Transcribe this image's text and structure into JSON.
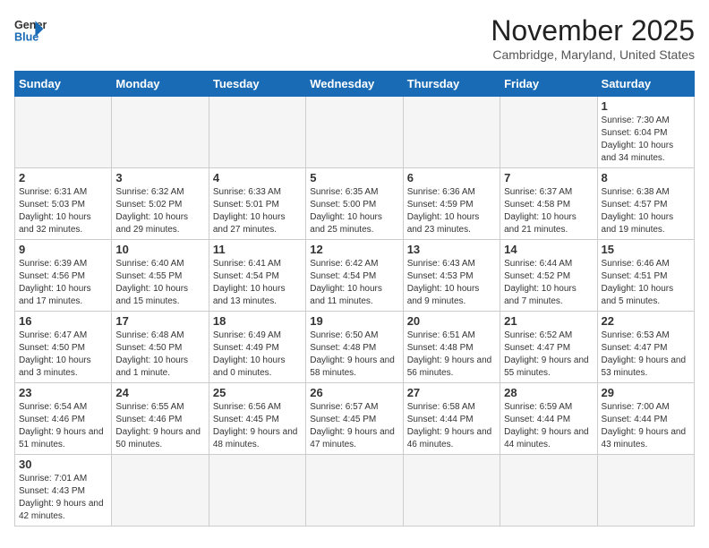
{
  "header": {
    "logo_line1": "General",
    "logo_line2": "Blue",
    "month": "November 2025",
    "location": "Cambridge, Maryland, United States"
  },
  "days_of_week": [
    "Sunday",
    "Monday",
    "Tuesday",
    "Wednesday",
    "Thursday",
    "Friday",
    "Saturday"
  ],
  "weeks": [
    [
      {
        "day": "",
        "empty": true
      },
      {
        "day": "",
        "empty": true
      },
      {
        "day": "",
        "empty": true
      },
      {
        "day": "",
        "empty": true
      },
      {
        "day": "",
        "empty": true
      },
      {
        "day": "",
        "empty": true
      },
      {
        "day": "1",
        "info": "Sunrise: 7:30 AM\nSunset: 6:04 PM\nDaylight: 10 hours\nand 34 minutes."
      }
    ],
    [
      {
        "day": "2",
        "info": "Sunrise: 6:31 AM\nSunset: 5:03 PM\nDaylight: 10 hours\nand 32 minutes."
      },
      {
        "day": "3",
        "info": "Sunrise: 6:32 AM\nSunset: 5:02 PM\nDaylight: 10 hours\nand 29 minutes."
      },
      {
        "day": "4",
        "info": "Sunrise: 6:33 AM\nSunset: 5:01 PM\nDaylight: 10 hours\nand 27 minutes."
      },
      {
        "day": "5",
        "info": "Sunrise: 6:35 AM\nSunset: 5:00 PM\nDaylight: 10 hours\nand 25 minutes."
      },
      {
        "day": "6",
        "info": "Sunrise: 6:36 AM\nSunset: 4:59 PM\nDaylight: 10 hours\nand 23 minutes."
      },
      {
        "day": "7",
        "info": "Sunrise: 6:37 AM\nSunset: 4:58 PM\nDaylight: 10 hours\nand 21 minutes."
      },
      {
        "day": "8",
        "info": "Sunrise: 6:38 AM\nSunset: 4:57 PM\nDaylight: 10 hours\nand 19 minutes."
      }
    ],
    [
      {
        "day": "9",
        "info": "Sunrise: 6:39 AM\nSunset: 4:56 PM\nDaylight: 10 hours\nand 17 minutes."
      },
      {
        "day": "10",
        "info": "Sunrise: 6:40 AM\nSunset: 4:55 PM\nDaylight: 10 hours\nand 15 minutes."
      },
      {
        "day": "11",
        "info": "Sunrise: 6:41 AM\nSunset: 4:54 PM\nDaylight: 10 hours\nand 13 minutes."
      },
      {
        "day": "12",
        "info": "Sunrise: 6:42 AM\nSunset: 4:54 PM\nDaylight: 10 hours\nand 11 minutes."
      },
      {
        "day": "13",
        "info": "Sunrise: 6:43 AM\nSunset: 4:53 PM\nDaylight: 10 hours\nand 9 minutes."
      },
      {
        "day": "14",
        "info": "Sunrise: 6:44 AM\nSunset: 4:52 PM\nDaylight: 10 hours\nand 7 minutes."
      },
      {
        "day": "15",
        "info": "Sunrise: 6:46 AM\nSunset: 4:51 PM\nDaylight: 10 hours\nand 5 minutes."
      }
    ],
    [
      {
        "day": "16",
        "info": "Sunrise: 6:47 AM\nSunset: 4:50 PM\nDaylight: 10 hours\nand 3 minutes."
      },
      {
        "day": "17",
        "info": "Sunrise: 6:48 AM\nSunset: 4:50 PM\nDaylight: 10 hours\nand 1 minute."
      },
      {
        "day": "18",
        "info": "Sunrise: 6:49 AM\nSunset: 4:49 PM\nDaylight: 10 hours\nand 0 minutes."
      },
      {
        "day": "19",
        "info": "Sunrise: 6:50 AM\nSunset: 4:48 PM\nDaylight: 9 hours\nand 58 minutes."
      },
      {
        "day": "20",
        "info": "Sunrise: 6:51 AM\nSunset: 4:48 PM\nDaylight: 9 hours\nand 56 minutes."
      },
      {
        "day": "21",
        "info": "Sunrise: 6:52 AM\nSunset: 4:47 PM\nDaylight: 9 hours\nand 55 minutes."
      },
      {
        "day": "22",
        "info": "Sunrise: 6:53 AM\nSunset: 4:47 PM\nDaylight: 9 hours\nand 53 minutes."
      }
    ],
    [
      {
        "day": "23",
        "info": "Sunrise: 6:54 AM\nSunset: 4:46 PM\nDaylight: 9 hours\nand 51 minutes."
      },
      {
        "day": "24",
        "info": "Sunrise: 6:55 AM\nSunset: 4:46 PM\nDaylight: 9 hours\nand 50 minutes."
      },
      {
        "day": "25",
        "info": "Sunrise: 6:56 AM\nSunset: 4:45 PM\nDaylight: 9 hours\nand 48 minutes."
      },
      {
        "day": "26",
        "info": "Sunrise: 6:57 AM\nSunset: 4:45 PM\nDaylight: 9 hours\nand 47 minutes."
      },
      {
        "day": "27",
        "info": "Sunrise: 6:58 AM\nSunset: 4:44 PM\nDaylight: 9 hours\nand 46 minutes."
      },
      {
        "day": "28",
        "info": "Sunrise: 6:59 AM\nSunset: 4:44 PM\nDaylight: 9 hours\nand 44 minutes."
      },
      {
        "day": "29",
        "info": "Sunrise: 7:00 AM\nSunset: 4:44 PM\nDaylight: 9 hours\nand 43 minutes."
      }
    ],
    [
      {
        "day": "30",
        "info": "Sunrise: 7:01 AM\nSunset: 4:43 PM\nDaylight: 9 hours\nand 42 minutes."
      },
      {
        "day": "",
        "empty": true
      },
      {
        "day": "",
        "empty": true
      },
      {
        "day": "",
        "empty": true
      },
      {
        "day": "",
        "empty": true
      },
      {
        "day": "",
        "empty": true
      },
      {
        "day": "",
        "empty": true
      }
    ]
  ]
}
